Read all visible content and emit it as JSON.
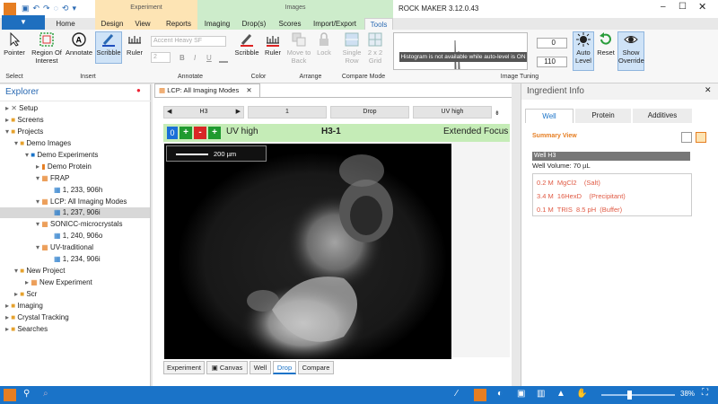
{
  "window": {
    "title": "ROCK MAKER 3.12.0.43"
  },
  "app_menu": {
    "label": "▼"
  },
  "context_groups": {
    "experiment": "Experiment",
    "images": "Images"
  },
  "tabs": [
    "Home",
    "Design",
    "View",
    "Reports",
    "Imaging",
    "Drop(s)",
    "Scores",
    "Import/Export",
    "Tools"
  ],
  "ribbon": {
    "select": {
      "pointer": "Pointer",
      "group": "Select"
    },
    "insert": {
      "region": "Region Of Interest",
      "annotate": "Annotate",
      "scribble": "Scribble",
      "ruler": "Ruler",
      "group": "Insert"
    },
    "annotate": {
      "font": "Accent Heavy SF",
      "size": "2",
      "bold": "B",
      "italic": "I",
      "underline": "U",
      "group": "Annotate"
    },
    "color": {
      "scribble": "Scribble",
      "ruler": "Ruler",
      "group": "Color"
    },
    "arrange": {
      "move_back": "Move to Back",
      "lock": "Lock",
      "group": "Arrange"
    },
    "compare": {
      "single_row": "Single Row",
      "grid": "2 x 2 Grid",
      "group": "Compare Mode"
    },
    "tuning": {
      "histogram_msg": "Histogram is not available while auto-level is ON",
      "low": "0",
      "high": "110",
      "auto_level": "Auto Level",
      "reset": "Reset",
      "show_override": "Show Override",
      "group": "Image Tuning"
    }
  },
  "explorer": {
    "title": "Explorer",
    "items": [
      {
        "label": "Setup"
      },
      {
        "label": "Screens"
      },
      {
        "label": "Projects"
      },
      {
        "label": "Demo Images"
      },
      {
        "label": "Demo Experiments"
      },
      {
        "label": "Demo Protein"
      },
      {
        "label": "FRAP"
      },
      {
        "label": "1, 233, 906h"
      },
      {
        "label": "LCP: All Imaging Modes"
      },
      {
        "label": "1, 237, 906i"
      },
      {
        "label": "SONICC-microcrystals"
      },
      {
        "label": "1, 240, 906o"
      },
      {
        "label": "UV-traditional"
      },
      {
        "label": "1, 234, 906i"
      },
      {
        "label": "New Project"
      },
      {
        "label": "New Experiment"
      },
      {
        "label": "Scr"
      },
      {
        "label": "Imaging"
      },
      {
        "label": "Crystal Tracking"
      },
      {
        "label": "Searches"
      }
    ]
  },
  "document": {
    "tab_title": "LCP: All Imaging Modes",
    "nav": {
      "well": "H3",
      "drop_num": "1",
      "drop": "Drop",
      "mode": "UV high"
    },
    "score": {
      "value": "0"
    },
    "imaging_mode": "UV high",
    "drop_id": "H3-1",
    "focus": "Extended Focus",
    "scale_label": "200 µm",
    "bottom_tabs": [
      "Experiment",
      "Canvas",
      "Well",
      "Drop",
      "Compare"
    ],
    "active_bottom_tab": "Drop"
  },
  "ingredient_info": {
    "title": "Ingredient Info",
    "tabs": [
      "Well",
      "Protein",
      "Additives"
    ],
    "summary_view": "Summary View",
    "well_name": "Well H3",
    "well_volume": "Well Volume: 70 µL",
    "ingredients": [
      "0.2 M  MgCl2    (Salt)",
      "3.4 M  16HexD    (Precipitant)",
      "0.1 M  TRIS  8.5 pH  (Buffer)"
    ]
  },
  "status": {
    "zoom": "38%",
    "zoom_fraction": 0.38
  },
  "colors": {
    "accent": "#1a73c8",
    "orange": "#e67e22",
    "green_bar": "#c5ecb7",
    "ingredient_red": "#e05a44"
  }
}
